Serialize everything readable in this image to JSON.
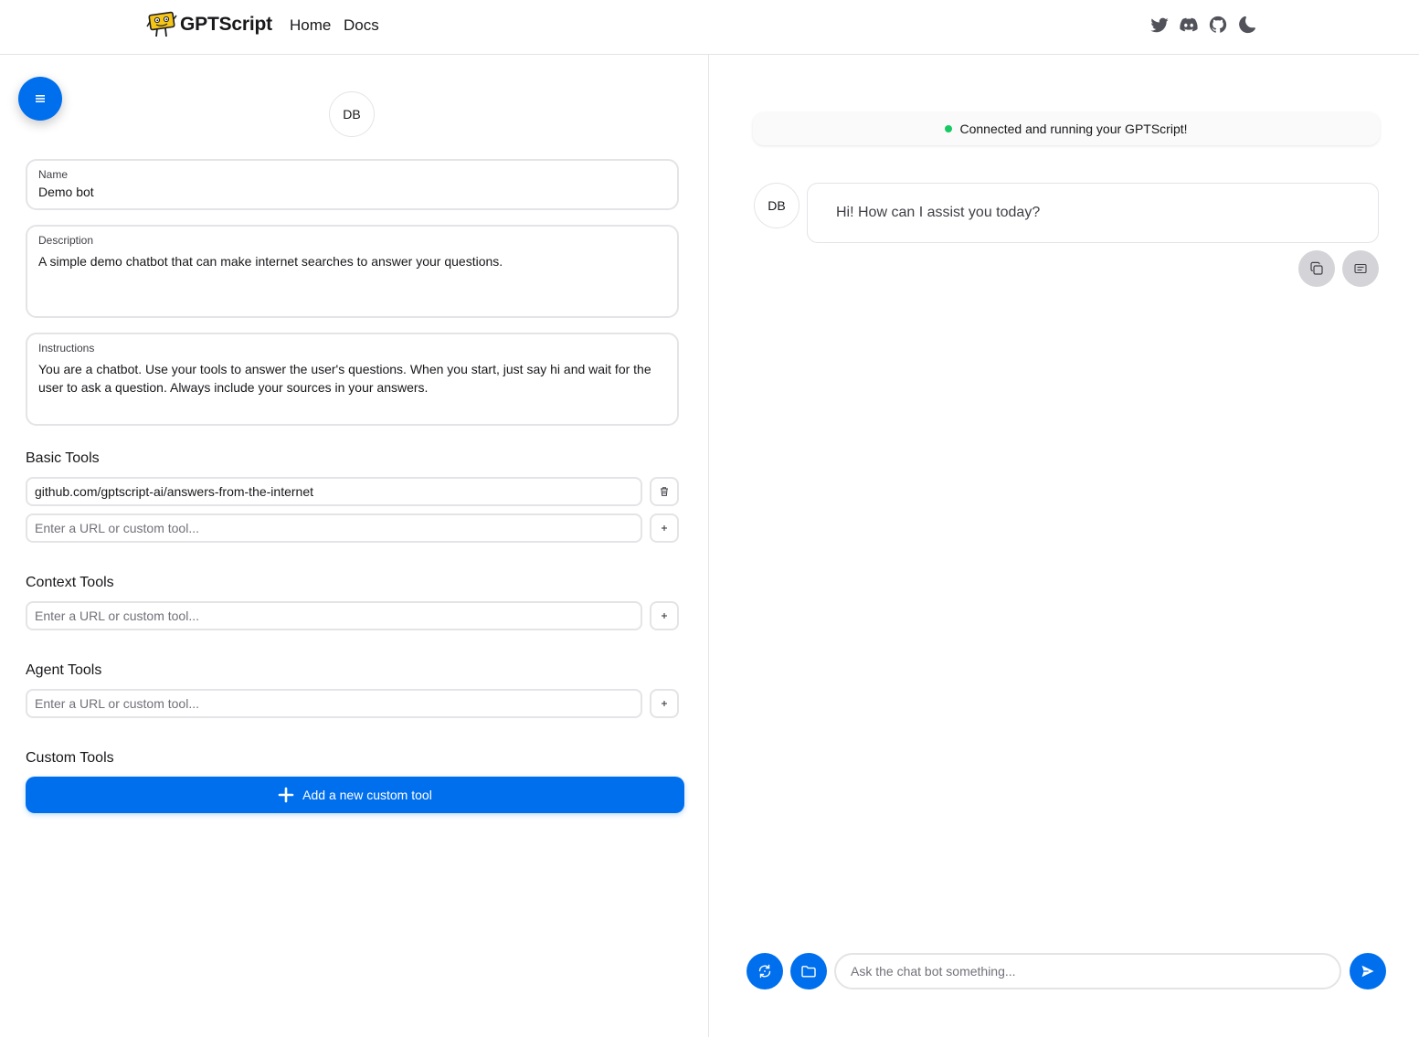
{
  "nav": {
    "brand": "GPTScript",
    "links": [
      "Home",
      "Docs"
    ],
    "icons": [
      "twitter-icon",
      "discord-icon",
      "github-icon",
      "moon-icon"
    ]
  },
  "editor": {
    "avatar_initials": "DB",
    "name": {
      "label": "Name",
      "value": "Demo bot"
    },
    "description": {
      "label": "Description",
      "value": "A simple demo chatbot that can make internet searches to answer your questions."
    },
    "instructions": {
      "label": "Instructions",
      "value": "You are a chatbot. Use your tools to answer the user's questions. When you start, just say hi and wait for the user to ask a question. Always include your sources in your answers."
    },
    "basic_tools": {
      "title": "Basic Tools",
      "items": [
        "github.com/gptscript-ai/answers-from-the-internet"
      ],
      "placeholder": "Enter a URL or custom tool..."
    },
    "context_tools": {
      "title": "Context Tools",
      "placeholder": "Enter a URL or custom tool..."
    },
    "agent_tools": {
      "title": "Agent Tools",
      "placeholder": "Enter a URL or custom tool..."
    },
    "custom_tools": {
      "title": "Custom Tools",
      "add_label": "Add a new custom tool"
    }
  },
  "chat": {
    "status": "Connected and running your GPTScript!",
    "status_color": "#17c964",
    "bot_initials": "DB",
    "messages": [
      {
        "role": "bot",
        "text": "Hi! How can I assist you today?"
      }
    ],
    "input_placeholder": "Ask the chat bot something..."
  },
  "colors": {
    "accent": "#006fee",
    "border": "#e4e4e7"
  }
}
